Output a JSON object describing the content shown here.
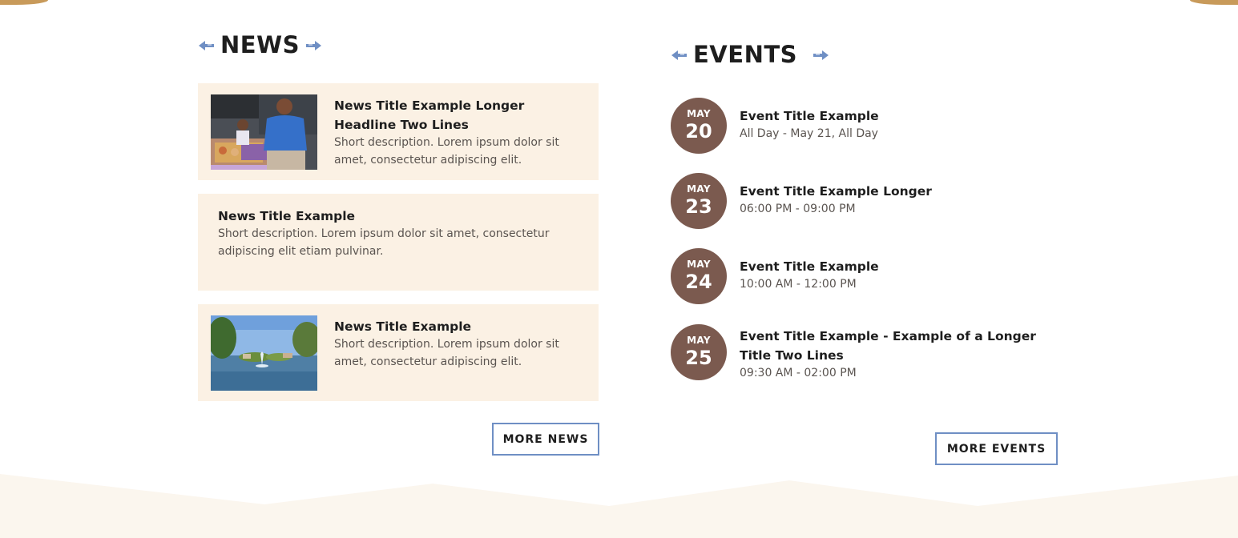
{
  "news": {
    "heading": "NEWS",
    "items": [
      {
        "title": "News Title Example Longer Headline Two Lines",
        "description": "Short description. Lorem ipsum dolor sit amet, consectetur adipiscing elit."
      },
      {
        "title": "News Title Example",
        "description": "Short description. Lorem ipsum dolor sit amet, consectetur adipiscing elit etiam pulvinar."
      },
      {
        "title": "News Title Example",
        "description": "Short description. Lorem ipsum dolor sit amet, consectetur adipiscing elit."
      }
    ],
    "more_label": "MORE NEWS"
  },
  "events": {
    "heading": "EVENTS",
    "items": [
      {
        "month": "MAY",
        "day": "20",
        "title": "Event Title Example",
        "time": "All Day - May 21, All Day"
      },
      {
        "month": "MAY",
        "day": "23",
        "title": "Event Title Example Longer",
        "time": "06:00 PM - 09:00 PM"
      },
      {
        "month": "MAY",
        "day": "24",
        "title": "Event Title Example",
        "time": "10:00 AM - 12:00 PM"
      },
      {
        "month": "MAY",
        "day": "25",
        "title": "Event Title Example - Example of a Longer Title Two Lines",
        "time": "09:30 AM - 02:00 PM"
      }
    ],
    "more_label": "MORE EVENTS"
  },
  "colors": {
    "accent_blue": "#6f8fc4",
    "card_bg": "#fbf1e4",
    "date_circle": "#7b5a4f",
    "gold_trim": "#c89a5a"
  },
  "icons": [
    "arrow-ornament-left-icon",
    "arrow-ornament-right-icon"
  ]
}
